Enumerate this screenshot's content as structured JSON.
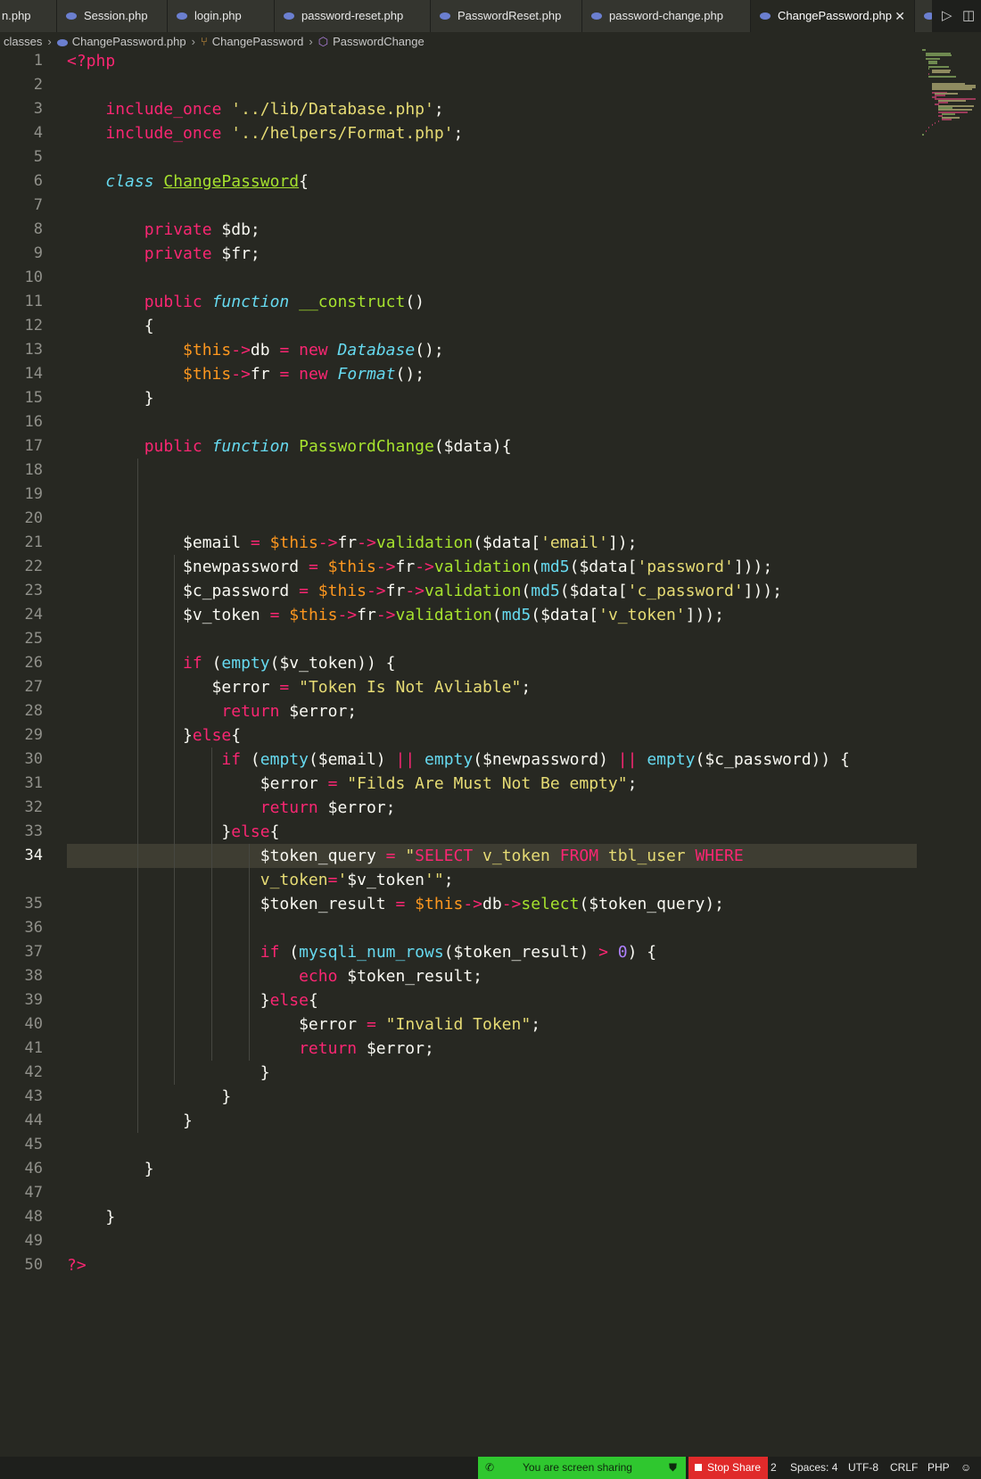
{
  "tabs": [
    {
      "label": "n.php"
    },
    {
      "label": "Session.php"
    },
    {
      "label": "login.php"
    },
    {
      "label": "password-reset.php"
    },
    {
      "label": "PasswordReset.php"
    },
    {
      "label": "password-change.php"
    },
    {
      "label": "ChangePassword.php",
      "active": true
    }
  ],
  "breadcrumb": {
    "folder": "classes",
    "file": "ChangePassword.php",
    "class": "ChangePassword",
    "method": "PasswordChange"
  },
  "editor": {
    "current_line": 34,
    "line_numbers": [
      "1",
      "2",
      "3",
      "4",
      "5",
      "6",
      "7",
      "8",
      "9",
      "10",
      "11",
      "12",
      "13",
      "14",
      "15",
      "16",
      "17",
      "18",
      "19",
      "20",
      "21",
      "22",
      "23",
      "24",
      "25",
      "26",
      "27",
      "28",
      "29",
      "30",
      "31",
      "32",
      "33",
      "34",
      "",
      "35",
      "36",
      "37",
      "38",
      "39",
      "40",
      "41",
      "42",
      "43",
      "44",
      "45",
      "46",
      "47",
      "48",
      "49",
      "50"
    ],
    "lines": [
      "<?php",
      "",
      "    include_once '../lib/Database.php';",
      "    include_once '../helpers/Format.php';",
      "",
      "    class ChangePassword{",
      "",
      "        private $db;",
      "        private $fr;",
      "",
      "        public function __construct()",
      "        {",
      "            $this->db = new Database();",
      "            $this->fr = new Format();",
      "        }",
      "",
      "        public function PasswordChange($data){",
      "",
      "",
      "",
      "            $email = $this->fr->validation($data['email']);",
      "            $newpassword = $this->fr->validation(md5($data['password']));",
      "            $c_password = $this->fr->validation(md5($data['c_password']));",
      "            $v_token = $this->fr->validation(md5($data['v_token']));",
      "",
      "            if (empty($v_token)) {",
      "               $error = \"Token Is Not Avliable\";",
      "                return $error;",
      "            }else{",
      "                if (empty($email) || empty($newpassword) || empty($c_password)) {",
      "                    $error = \"Filds Are Must Not Be empty\";",
      "                    return $error;",
      "                }else{",
      "                    $token_query = \"SELECT v_token FROM tbl_user WHERE",
      "                    v_token='$v_token'\";",
      "                    $token_result = $this->db->select($token_query);",
      "",
      "                    if (mysqli_num_rows($token_result) > 0) {",
      "                        echo $token_result;",
      "                    }else{",
      "                        $error = \"Invalid Token\";",
      "                        return $error;",
      "                    }",
      "                }",
      "            }",
      "",
      "        }",
      "",
      "    }",
      "",
      "?>"
    ]
  },
  "statusbar": {
    "screen_sharing": "You are screen sharing",
    "stop_share": "Stop Share",
    "line_fragment": "2",
    "spaces": "Spaces: 4",
    "encoding": "UTF-8",
    "line_endings": "CRLF",
    "language": "PHP"
  },
  "icons": {
    "php_file": "php-file-icon",
    "class": "class-icon",
    "method": "method-icon",
    "run": "run-icon",
    "split_editor": "split-editor-icon",
    "close": "close-icon",
    "phone": "phone-icon",
    "shield": "shield-icon",
    "stop": "stop-icon",
    "feedback": "feedback-icon"
  },
  "colors": {
    "background": "#272822",
    "keyword": "#f92672",
    "string": "#e6db74",
    "function": "#a6e22e",
    "storage": "#66d9ef",
    "variable_this": "#fd971f",
    "number": "#ae81ff",
    "sharing_bar": "#2fc72f",
    "stop_share": "#e02a2a"
  }
}
